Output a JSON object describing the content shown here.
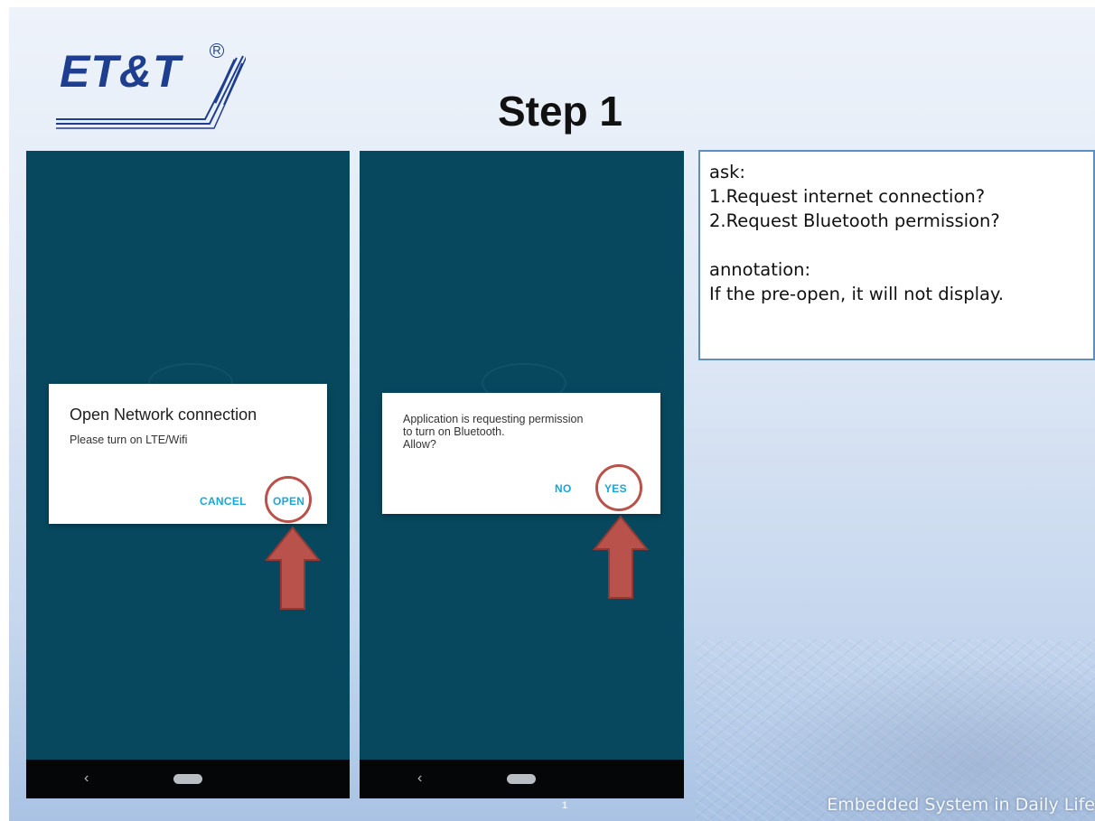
{
  "slide": {
    "logo_text": "ET&T",
    "logo_reg": "R",
    "title": "Step 1",
    "page_number": "1",
    "footer": "Embedded System in Daily Life"
  },
  "phone1": {
    "dialog_title": "Open Network connection",
    "dialog_message": "Please turn on LTE/Wifi",
    "cancel_label": "CANCEL",
    "open_label": "OPEN",
    "nav_back": "‹"
  },
  "phone2": {
    "dialog_message": "Application is requesting permission\nto turn on Bluetooth.\nAllow?",
    "no_label": "NO",
    "yes_label": "YES",
    "nav_back": "‹"
  },
  "notes": {
    "ask_heading": "ask:",
    "ask_items": [
      "1.Request internet connection?",
      "2.Request Bluetooth permission?"
    ],
    "annotation_heading": "annotation:",
    "annotation_text": "If the pre-open, it will not display."
  },
  "colors": {
    "phone_bg": "#07485f",
    "accent_button": "#19a7d8",
    "highlight": "#b8524a",
    "logo": "#1e3f8f"
  }
}
